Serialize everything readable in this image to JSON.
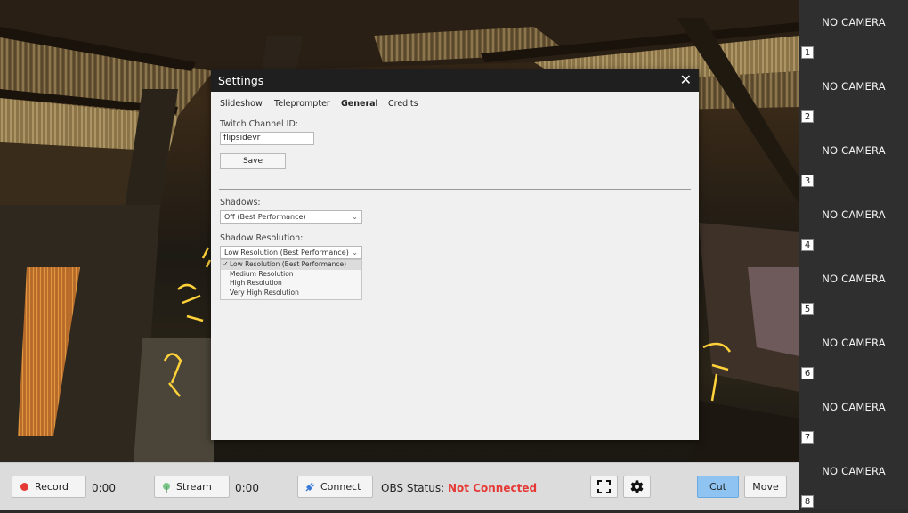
{
  "cameras": [
    {
      "label": "NO CAMERA",
      "number": "1"
    },
    {
      "label": "NO CAMERA",
      "number": "2"
    },
    {
      "label": "NO CAMERA",
      "number": "3"
    },
    {
      "label": "NO CAMERA",
      "number": "4"
    },
    {
      "label": "NO CAMERA",
      "number": "5"
    },
    {
      "label": "NO CAMERA",
      "number": "6"
    },
    {
      "label": "NO CAMERA",
      "number": "7"
    },
    {
      "label": "NO CAMERA",
      "number": "8"
    }
  ],
  "bottom_bar": {
    "record_label": "Record",
    "record_time": "0:00",
    "stream_label": "Stream",
    "stream_time": "0:00",
    "connect_label": "Connect",
    "obs_status_label": "OBS Status:",
    "obs_status_value": "Not Connected",
    "cut_label": "Cut",
    "move_label": "Move",
    "fullscreen_icon": "fullscreen-icon",
    "settings_icon": "gear-icon"
  },
  "settings": {
    "title": "Settings",
    "close_icon": "close-icon",
    "tabs": [
      "Slideshow",
      "Teleprompter",
      "General",
      "Credits"
    ],
    "active_tab": "General",
    "twitch_label": "Twitch Channel ID:",
    "twitch_value": "flipsidevr",
    "save_label": "Save",
    "shadows_label": "Shadows:",
    "shadows_value": "Off (Best Performance)",
    "shadow_res_label": "Shadow Resolution:",
    "shadow_res_value": "Low Resolution (Best Performance)",
    "shadow_res_options": [
      "Low Resolution (Best Performance)",
      "Medium Resolution",
      "High Resolution",
      "Very High Resolution"
    ]
  },
  "colors": {
    "accent": "#4a90e2",
    "cut_button": "#8fc4f2",
    "status_error": "#e53935",
    "record_dot": "#e53935"
  }
}
